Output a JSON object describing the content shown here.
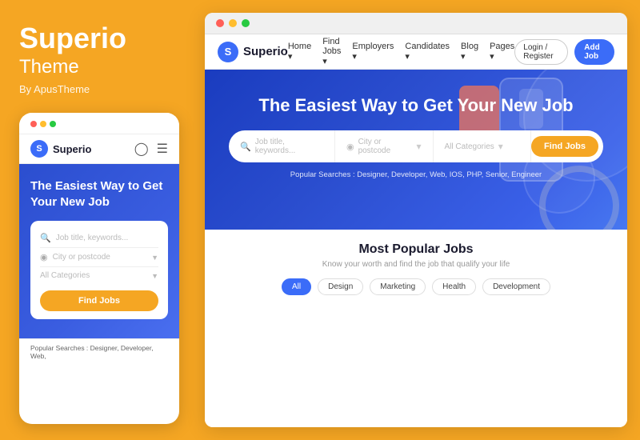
{
  "brand": {
    "title": "Superio",
    "subtitle": "Theme",
    "by": "By ApusTheme"
  },
  "mobile": {
    "logo_text": "Superio",
    "logo_initial": "S",
    "hero_title": "The Easiest Way to Get Your New Job",
    "search_placeholder": "Job title, keywords...",
    "location_placeholder": "City or postcode",
    "category_placeholder": "All Categories",
    "find_btn": "Find Jobs",
    "popular_label": "Popular Searches : Designer, Developer, Web,"
  },
  "browser": {
    "site_logo_text": "Superio",
    "site_logo_initial": "S",
    "nav_links": [
      "Home",
      "Find Jobs",
      "Employers",
      "Candidates",
      "Blog",
      "Pages"
    ],
    "btn_login": "Login / Register",
    "btn_add_job": "Add Job",
    "hero_title": "The Easiest Way to Get Your New Job",
    "search_placeholder": "Job title, keywords...",
    "location_placeholder": "City or postcode",
    "category_placeholder": "All Categories",
    "find_btn": "Find Jobs",
    "popular_searches": "Popular Searches :  Designer, Developer, Web, IOS, PHP, Senior, Engineer",
    "popular_jobs_title": "Most Popular Jobs",
    "popular_jobs_sub": "Know your worth and find the job that qualify your life",
    "tags": [
      "All",
      "Design",
      "Marketing",
      "Health",
      "Development"
    ]
  },
  "dots": {
    "red": "#FF5F57",
    "yellow": "#FFBD2E",
    "green": "#28CA42"
  }
}
